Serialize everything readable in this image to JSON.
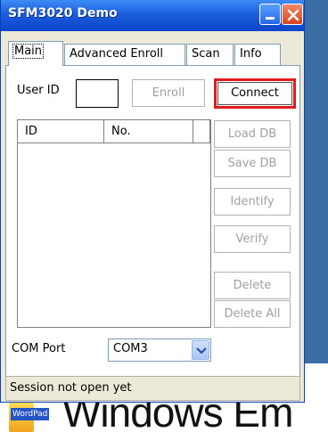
{
  "window": {
    "title": "SFM3020 Demo"
  },
  "tabs": [
    {
      "label": "Main"
    },
    {
      "label": "Advanced Enroll"
    },
    {
      "label": "Scan"
    },
    {
      "label": "Info"
    }
  ],
  "main": {
    "user_id_label": "User ID",
    "user_id_value": "",
    "enroll_button": "Enroll",
    "connect_button": "Connect",
    "table": {
      "columns": [
        "ID",
        "No."
      ],
      "rows": []
    },
    "side_buttons": {
      "load_db": "Load DB",
      "save_db": "Save DB",
      "identify": "Identify",
      "verify": "Verify",
      "delete": "Delete",
      "delete_all": "Delete All"
    },
    "com_port_label": "COM Port",
    "com_port_value": "COM3",
    "status": "Session not open yet"
  },
  "desktop": {
    "taskbar_label": "WordPad",
    "background_text": "Windows Em"
  },
  "colors": {
    "highlight_border": "#e21b1b",
    "titlebar": "#1b5ddd",
    "window_face": "#ece9d8"
  }
}
